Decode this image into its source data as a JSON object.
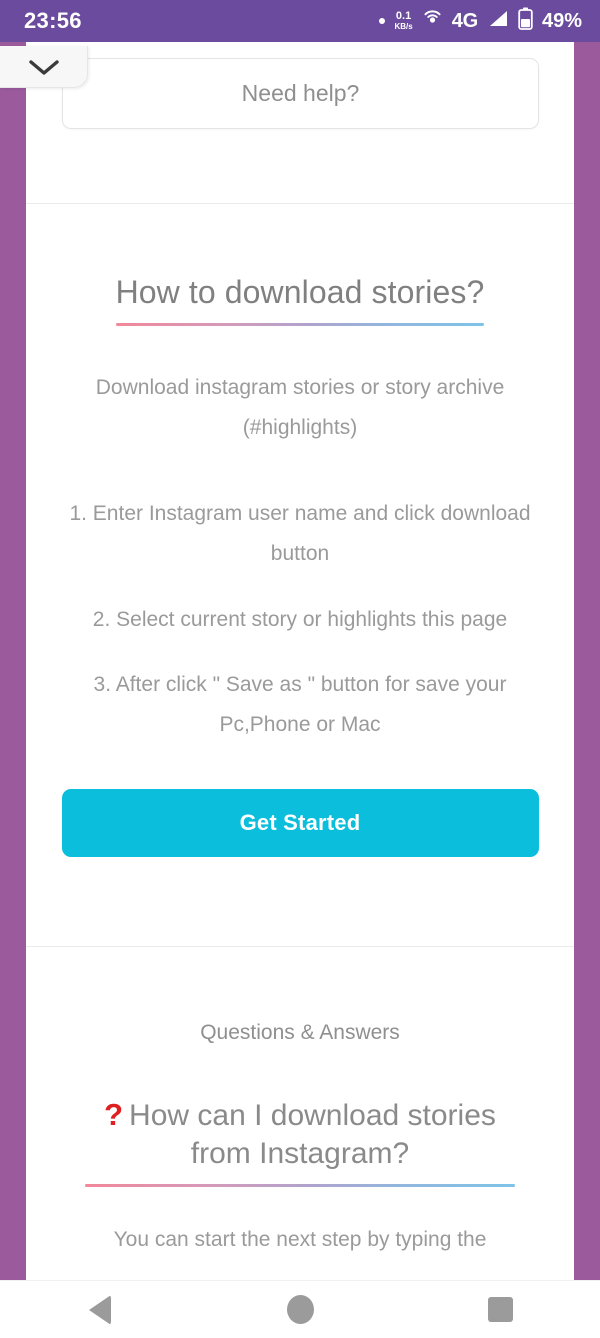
{
  "status_bar": {
    "clock": "23:56",
    "net_speed_value": "0.1",
    "net_speed_unit": "KB/s",
    "network_type": "4G",
    "battery_percent": "49%",
    "icons": [
      "dot-icon",
      "network-speed-icon",
      "hotspot-icon",
      "signal-icon",
      "battery-icon"
    ],
    "background_color": "#6a4b9e"
  },
  "page_chrome": {
    "side_strip_color": "#9a5a9c",
    "collapse_tab_icon": "chevron-down-icon"
  },
  "help_bar": {
    "label": "Need help?"
  },
  "howto": {
    "title": "How to download stories?",
    "subtitle": "Download instagram stories or story archive (#highlights)",
    "steps": [
      "1. Enter Instagram user name and click download button",
      "2. Select current story or highlights this page",
      "3. After click \" Save as \" button for save your Pc,Phone or Mac"
    ],
    "cta_label": "Get Started",
    "cta_color": "#0bbedb",
    "rule_gradient_from": "#f2889a",
    "rule_gradient_to": "#7ec4e8"
  },
  "qa": {
    "heading": "Questions & Answers",
    "question_marker": "?",
    "question_marker_color": "#e02020",
    "question": "How can I download stories from Instagram?",
    "answer": "You can start the next step by typing the"
  },
  "nav_bar": {
    "back_label": "Back",
    "home_label": "Home",
    "recents_label": "Recent apps"
  }
}
